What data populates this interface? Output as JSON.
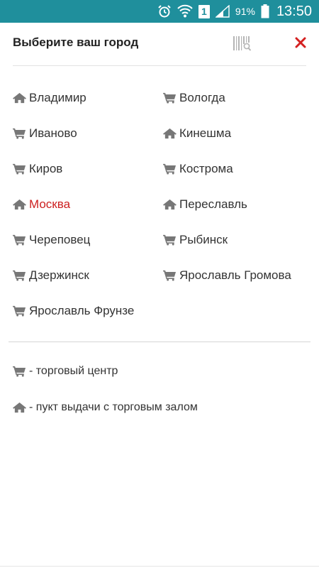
{
  "status_bar": {
    "sim_slot": "1",
    "battery_percent": "91%",
    "time": "13:50"
  },
  "header": {
    "title": "Выберите ваш город"
  },
  "cities": [
    {
      "name": "Владимир",
      "type": "home-icon"
    },
    {
      "name": "Вологда",
      "type": "cart-icon"
    },
    {
      "name": "Иваново",
      "type": "cart-icon"
    },
    {
      "name": "Кинешма",
      "type": "home-icon"
    },
    {
      "name": "Киров",
      "type": "cart-icon"
    },
    {
      "name": "Кострома",
      "type": "cart-icon"
    },
    {
      "name": "Москва",
      "type": "home-icon",
      "selected": true
    },
    {
      "name": "Переславль",
      "type": "home-icon"
    },
    {
      "name": "Череповец",
      "type": "cart-icon"
    },
    {
      "name": "Рыбинск",
      "type": "cart-icon"
    },
    {
      "name": "Дзержинск",
      "type": "cart-icon"
    },
    {
      "name": "Ярославль Громова",
      "type": "cart-icon"
    },
    {
      "name": "Ярославль Фрунзе",
      "type": "cart-icon"
    }
  ],
  "legend": {
    "shopping_center": "- торговый центр",
    "pickup_point": "- пукт выдачи с торговым залом"
  },
  "colors": {
    "status_bar": "#1f8f9c",
    "accent_red": "#cc1f1f",
    "icon_gray": "#777777"
  }
}
